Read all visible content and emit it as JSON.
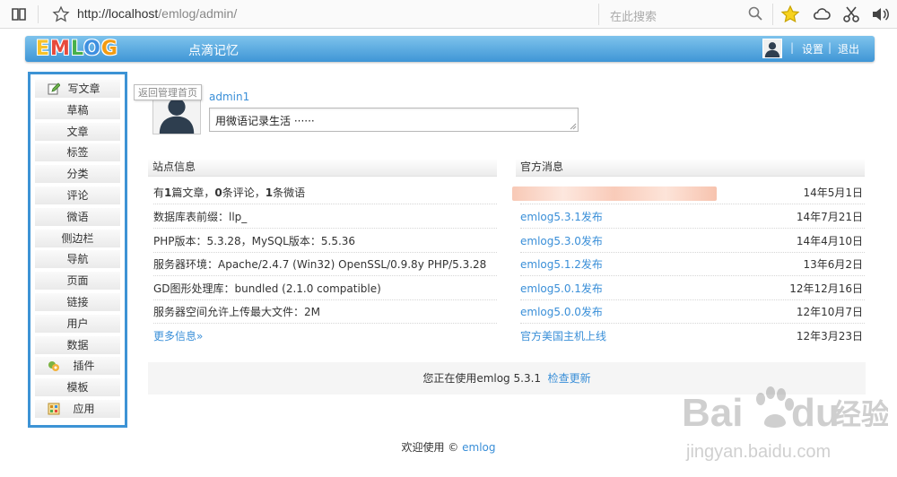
{
  "browser": {
    "url_host": "http://localhost",
    "url_path": "/emlog/admin/",
    "search_placeholder": "在此搜索"
  },
  "header": {
    "logo_letters": [
      "E",
      "M",
      "L",
      "O",
      "G"
    ],
    "logo_colors": [
      "#f6c22b",
      "#e74a3c",
      "#47b04b",
      "#3d8fe0",
      "#f39c12"
    ],
    "site_name": "点滴记忆",
    "settings": "设置",
    "logout": "退出",
    "sep": "|"
  },
  "sidebar": {
    "items": [
      {
        "label": "写文章",
        "icon": "pencil-icon"
      },
      {
        "label": "草稿"
      },
      {
        "label": "文章"
      },
      {
        "label": "标签"
      },
      {
        "label": "分类"
      },
      {
        "label": "评论"
      },
      {
        "label": "微语"
      },
      {
        "label": "侧边栏"
      },
      {
        "label": "导航"
      },
      {
        "label": "页面"
      },
      {
        "label": "链接"
      },
      {
        "label": "用户"
      },
      {
        "label": "数据"
      },
      {
        "label": "插件",
        "icon": "plugin-icon"
      },
      {
        "label": "模板"
      },
      {
        "label": "应用",
        "icon": "app-icon"
      }
    ]
  },
  "tooltip": "返回管理首页",
  "profile": {
    "username": "admin1",
    "tweet_value": "用微语记录生活 ······"
  },
  "site_info": {
    "title": "站点信息",
    "stats": {
      "posts": "1",
      "posts_label": "篇文章，",
      "comments": "0",
      "comments_label": "条评论，",
      "twitters": "1",
      "twitters_label": "条微语",
      "prefix": "有"
    },
    "rows": [
      "数据库表前缀：llp_",
      "PHP版本：5.3.28，MySQL版本：5.5.36",
      "服务器环境：Apache/2.4.7 (Win32) OpenSSL/0.9.8y PHP/5.3.28",
      "GD图形处理库：bundled (2.1.0 compatible)",
      "服务器空间允许上传最大文件：2M"
    ],
    "more": "更多信息»"
  },
  "news": {
    "title": "官方消息",
    "items": [
      {
        "text": "",
        "date": "14年5月1日"
      },
      {
        "text": "emlog5.3.1发布",
        "date": "14年7月21日"
      },
      {
        "text": "emlog5.3.0发布",
        "date": "14年4月10日"
      },
      {
        "text": "emlog5.1.2发布",
        "date": "13年6月2日"
      },
      {
        "text": "emlog5.0.1发布",
        "date": "12年12月16日"
      },
      {
        "text": "emlog5.0.0发布",
        "date": "12年10月7日"
      },
      {
        "text": "官方美国主机上线",
        "date": "12年3月23日"
      }
    ]
  },
  "version": {
    "text": "您正在使用emlog 5.3.1",
    "check_update": "检查更新"
  },
  "footer": {
    "welcome": "欢迎使用 ©",
    "link": "emlog"
  },
  "watermark": {
    "brand": "Bai",
    "brand2": "du",
    "cn": "经验",
    "url": "jingyan.baidu.com"
  }
}
